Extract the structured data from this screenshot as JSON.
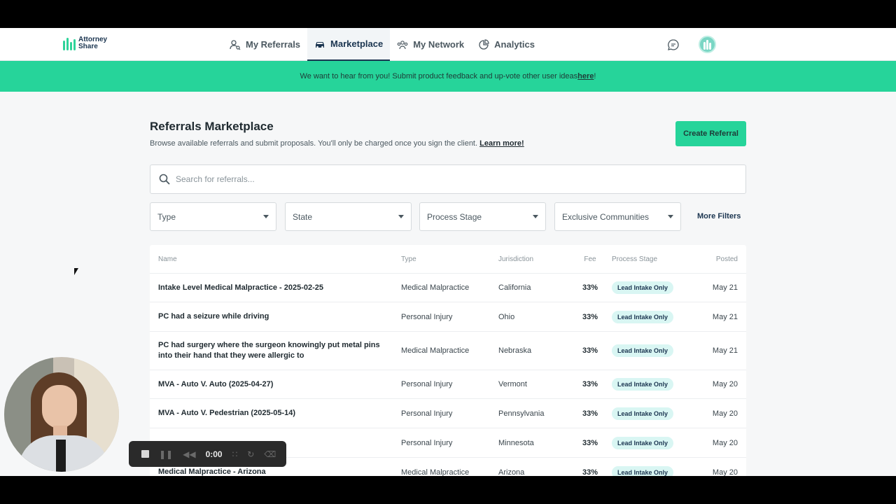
{
  "logo": {
    "line1": "Attorney",
    "line2": "Share"
  },
  "nav": {
    "items": [
      {
        "label": "My Referrals",
        "icon": "user-search-icon",
        "active": false
      },
      {
        "label": "Marketplace",
        "icon": "car-icon",
        "active": true
      },
      {
        "label": "My Network",
        "icon": "network-icon",
        "active": false
      },
      {
        "label": "Analytics",
        "icon": "chart-icon",
        "active": false
      }
    ]
  },
  "banner": {
    "text": "We want to hear from you! Submit product feedback and up-vote other user ideas ",
    "link": "here",
    "suffix": "!"
  },
  "header": {
    "title": "Referrals Marketplace",
    "subtitle": "Browse available referrals and submit proposals. You'll only be charged once you sign the client. ",
    "learn_more": "Learn more!",
    "create_button": "Create Referral"
  },
  "search": {
    "placeholder": "Search for referrals..."
  },
  "filters": {
    "items": [
      "Type",
      "State",
      "Process Stage",
      "Exclusive Communities"
    ],
    "more": "More Filters"
  },
  "table": {
    "columns": [
      "Name",
      "Type",
      "Jurisdiction",
      "Fee",
      "Process Stage",
      "Posted"
    ],
    "rows": [
      {
        "name": "Intake Level Medical Malpractice - 2025-02-25",
        "type": "Medical Malpractice",
        "jurisdiction": "California",
        "fee": "33%",
        "stage": "Lead Intake Only",
        "posted": "May 21"
      },
      {
        "name": "PC had a seizure while driving",
        "type": "Personal Injury",
        "jurisdiction": "Ohio",
        "fee": "33%",
        "stage": "Lead Intake Only",
        "posted": "May 21"
      },
      {
        "name": "PC had surgery where the surgeon knowingly put metal pins into their hand that they were allergic to",
        "type": "Medical Malpractice",
        "jurisdiction": "Nebraska",
        "fee": "33%",
        "stage": "Lead Intake Only",
        "posted": "May 21"
      },
      {
        "name": "MVA - Auto V. Auto (2025-04-27)",
        "type": "Personal Injury",
        "jurisdiction": "Vermont",
        "fee": "33%",
        "stage": "Lead Intake Only",
        "posted": "May 20"
      },
      {
        "name": "MVA - Auto V. Pedestrian (2025-05-14)",
        "type": "Personal Injury",
        "jurisdiction": "Pennsylvania",
        "fee": "33%",
        "stage": "Lead Intake Only",
        "posted": "May 20"
      },
      {
        "name": "",
        "type": "Personal Injury",
        "jurisdiction": "Minnesota",
        "fee": "33%",
        "stage": "Lead Intake Only",
        "posted": "May 20"
      },
      {
        "name": "Medical Malpractice - Arizona",
        "type": "Medical Malpractice",
        "jurisdiction": "Arizona",
        "fee": "33%",
        "stage": "Lead Intake Only",
        "posted": "May 20"
      }
    ]
  },
  "recorder": {
    "time": "0:00"
  },
  "colors": {
    "accent": "#26d49a",
    "navy": "#1b3550",
    "pill": "#d9f6f3"
  }
}
